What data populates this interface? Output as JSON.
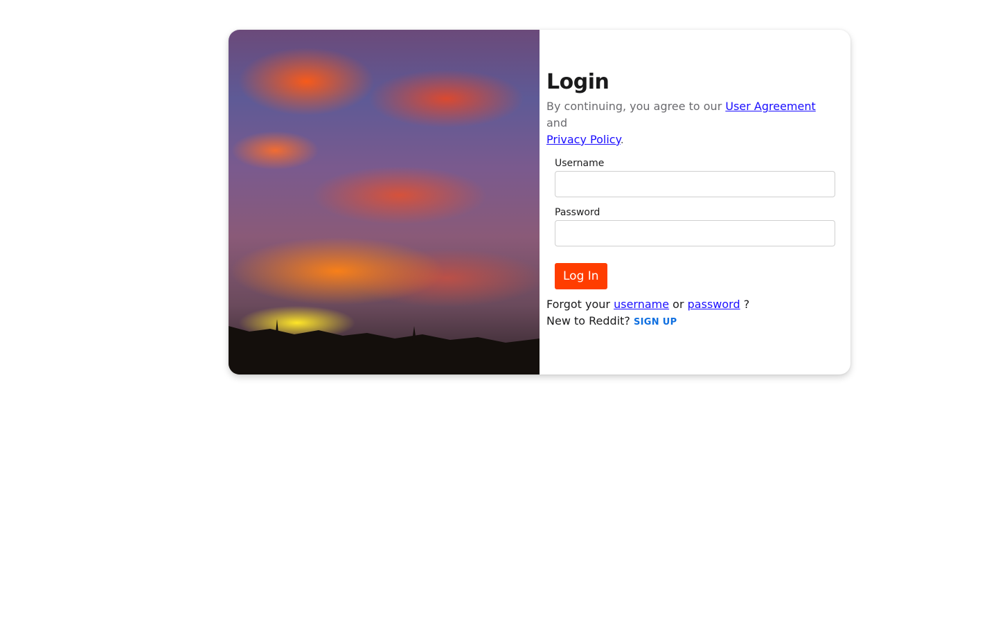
{
  "hero": {
    "image_label": "sunset-sky-photo"
  },
  "login": {
    "title": "Login",
    "agree_prefix": "By continuing, you agree to our ",
    "user_agreement": "User Agreement ",
    "agree_middle": "and",
    "privacy_policy": "Privacy Policy",
    "agree_suffix": ".",
    "username_label": "Username",
    "username_value": "",
    "password_label": "Password",
    "password_value": "",
    "submit_label": "Log In",
    "forgot_prefix": "Forgot your ",
    "forgot_username": "username",
    "forgot_or": " or ",
    "forgot_password": "password",
    "forgot_suffix": " ?",
    "new_prefix": "New to Reddit? ",
    "signup_label": "SIGN UP"
  },
  "colors": {
    "accent": "#ff3d00",
    "link": "#1a0dff",
    "signup": "#0f6fe0"
  }
}
